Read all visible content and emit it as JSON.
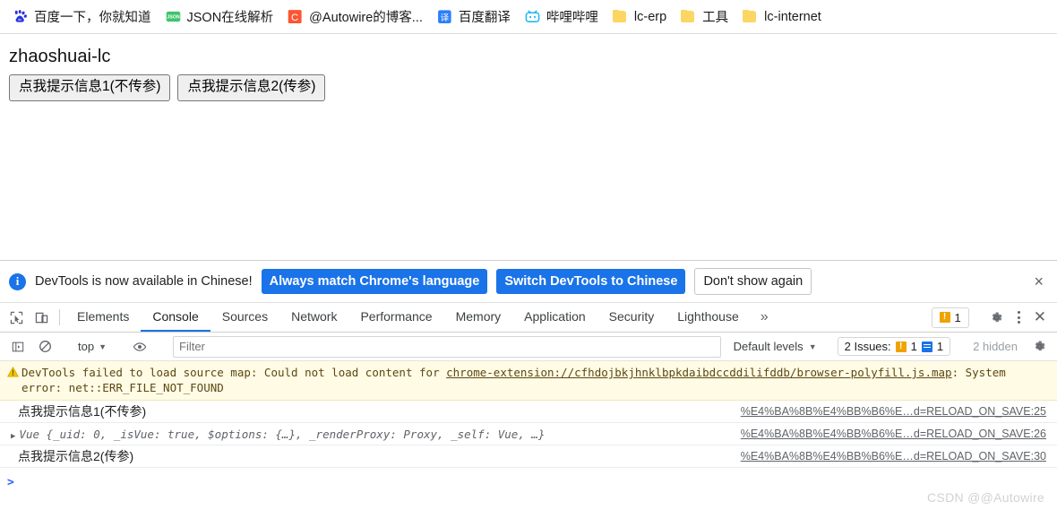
{
  "bookmarks": {
    "items": [
      {
        "label": "百度一下，你就知道",
        "icon": "baidu-icon",
        "icon_type": "baidu",
        "color": "#2932e1"
      },
      {
        "label": "JSON在线解析",
        "icon": "json-icon",
        "icon_type": "json",
        "color": "#3ec46d"
      },
      {
        "label": "@Autowire的博客...",
        "icon": "csdn-icon",
        "icon_type": "csdn",
        "color": "#fc5531"
      },
      {
        "label": "百度翻译",
        "icon": "translate-icon",
        "icon_type": "translate",
        "color": "#2d7ff9"
      },
      {
        "label": "哔哩哔哩",
        "icon": "bilibili-icon",
        "icon_type": "bilibili",
        "color": "#22b8f0"
      },
      {
        "label": "lc-erp",
        "icon": "folder-icon",
        "icon_type": "folder",
        "color": "#fcd663"
      },
      {
        "label": "工具",
        "icon": "folder-icon",
        "icon_type": "folder",
        "color": "#fcd663"
      },
      {
        "label": "lc-internet",
        "icon": "folder-icon",
        "icon_type": "folder",
        "color": "#fcd663"
      }
    ]
  },
  "page": {
    "title": "zhaoshuai-lc",
    "buttons": [
      {
        "label": "点我提示信息1(不传参)"
      },
      {
        "label": "点我提示信息2(传参)"
      }
    ]
  },
  "devtools": {
    "banner": {
      "icon": "info-icon",
      "message": "DevTools is now available in Chinese!",
      "primary_button": "Always match Chrome's language",
      "secondary_button": "Switch DevTools to Chinese",
      "dismiss_button": "Don't show again",
      "close_icon": "×"
    },
    "tabs": [
      {
        "label": "Elements",
        "active": false
      },
      {
        "label": "Console",
        "active": true
      },
      {
        "label": "Sources",
        "active": false
      },
      {
        "label": "Network",
        "active": false
      },
      {
        "label": "Performance",
        "active": false
      },
      {
        "label": "Memory",
        "active": false
      },
      {
        "label": "Application",
        "active": false
      },
      {
        "label": "Security",
        "active": false
      },
      {
        "label": "Lighthouse",
        "active": false
      }
    ],
    "more_tabs_icon": "»",
    "warning_badge_count": "1",
    "toolbar": {
      "context": "top",
      "filter_placeholder": "Filter",
      "filter_value": "",
      "levels_label": "Default levels",
      "issues_label": "2 Issues:",
      "issues_warning_count": "1",
      "issues_info_count": "1",
      "hidden_label": "2 hidden"
    },
    "console": {
      "warning_message": {
        "prefix": "DevTools failed to load source map: Could not load content for ",
        "link": "chrome-extension://cfhdojbkjhnklbpkdaibdccddilifddb/browser-polyfill.js.m",
        "link_tail": "ap",
        "suffix": ": System error: net::ERR_FILE_NOT_FOUND"
      },
      "rows": [
        {
          "type": "log",
          "text": "点我提示信息1(不传参)",
          "source": "%E4%BA%8B%E4%BB%B6%E…d=RELOAD_ON_SAVE:25",
          "cjk": true
        },
        {
          "type": "object",
          "expandable": true,
          "disclosure": "▶",
          "class_name": "Vue",
          "preview": "{_uid: 0, _isVue: true, $options: {…}, _renderProxy: Proxy, _self: Vue, …}",
          "source": "%E4%BA%8B%E4%BB%B6%E…d=RELOAD_ON_SAVE:26",
          "cjk": false
        },
        {
          "type": "log",
          "text": "点我提示信息2(传参)",
          "source": "%E4%BA%8B%E4%BB%B6%E…d=RELOAD_ON_SAVE:30",
          "cjk": true
        }
      ],
      "prompt": ">"
    }
  },
  "watermark": "CSDN @@Autowire"
}
